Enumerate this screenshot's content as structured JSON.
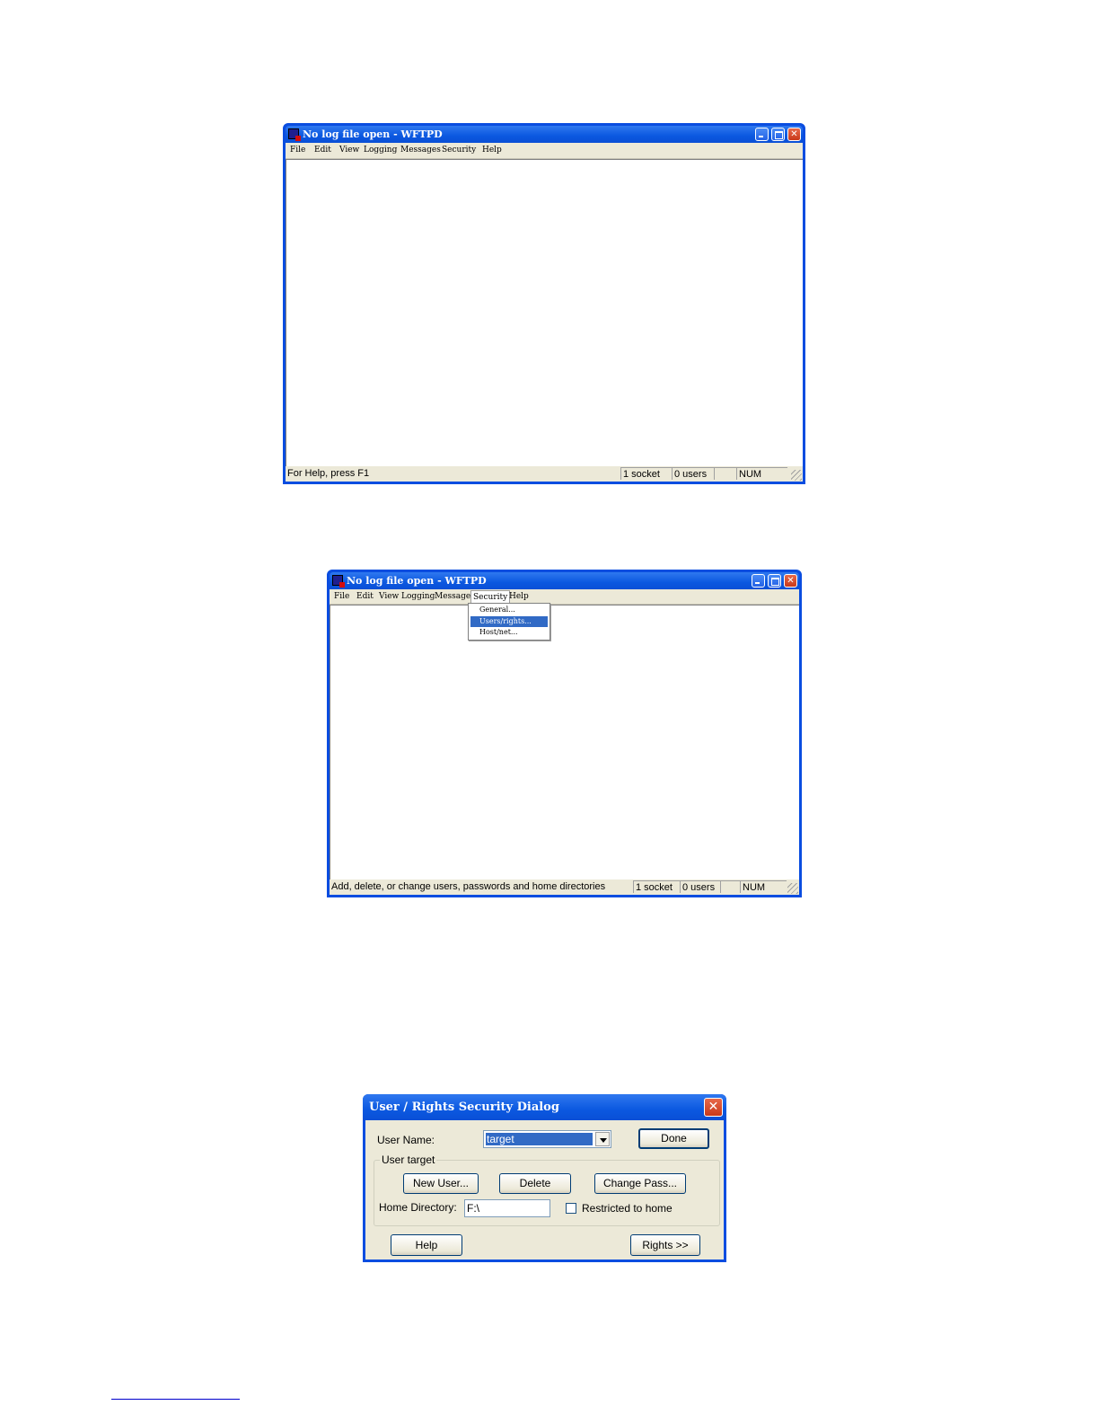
{
  "window1": {
    "title": "No log file open - WFTPD",
    "menu": [
      "File",
      "Edit",
      "View",
      "Logging",
      "Messages",
      "Security",
      "Help"
    ],
    "status": {
      "message": "For Help, press F1",
      "sockets": "1 socket",
      "users": "0 users",
      "empty": "",
      "num": "NUM"
    }
  },
  "window2": {
    "title": "No log file open - WFTPD",
    "menu": [
      "File",
      "Edit",
      "View",
      "Logging",
      "Messages",
      "Security",
      "Help"
    ],
    "open_menu": "Security",
    "dropdown": [
      "General...",
      "Users/rights...",
      "Host/net..."
    ],
    "selected_item": "Users/rights...",
    "status": {
      "message": "Add, delete, or change users, passwords and home directories",
      "sockets": "1 socket",
      "users": "0 users",
      "empty": "",
      "num": "NUM"
    }
  },
  "dialog": {
    "title": "User / Rights Security Dialog",
    "user_name_label": "User Name:",
    "user_name_value": "target",
    "done_label": "Done",
    "group_label": "User target",
    "new_user_label": "New User...",
    "delete_label": "Delete",
    "change_pass_label": "Change Pass...",
    "home_dir_label": "Home Directory:",
    "home_dir_value": "F:\\",
    "restricted_label": "Restricted to home",
    "restricted_checked": false,
    "help_label": "Help",
    "rights_label": "Rights >>"
  }
}
